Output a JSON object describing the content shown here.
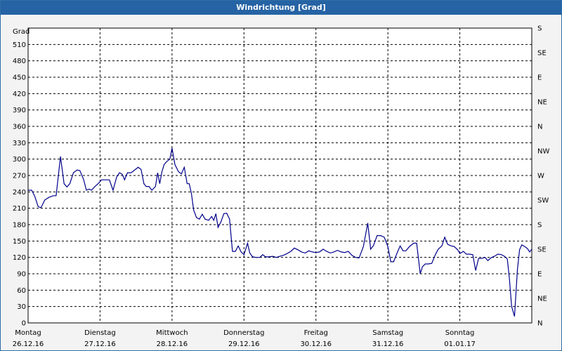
{
  "window": {
    "title": "Windrichtung [Grad]"
  },
  "chart_data": {
    "type": "line",
    "title": "Windrichtung [Grad]",
    "ylabel": "Grad",
    "ylim": [
      0,
      540
    ],
    "yticks": [
      0,
      30,
      60,
      90,
      120,
      150,
      180,
      210,
      240,
      270,
      300,
      330,
      360,
      390,
      420,
      450,
      480,
      510
    ],
    "right_axis_labels": [
      "N",
      "NE",
      "E",
      "SE",
      "S",
      "SW",
      "W",
      "NW",
      "N",
      "NE",
      "E",
      "SE",
      "S"
    ],
    "xlim": [
      0,
      7
    ],
    "day_labels": [
      {
        "day": "Montag",
        "date": "26.12.16"
      },
      {
        "day": "Dienstag",
        "date": "27.12.16"
      },
      {
        "day": "Mittwoch",
        "date": "28.12.16"
      },
      {
        "day": "Donnerstag",
        "date": "29.12.16"
      },
      {
        "day": "Freitag",
        "date": "30.12.16"
      },
      {
        "day": "Samstag",
        "date": "31.12.16"
      },
      {
        "day": "Sonntag",
        "date": "01.01.17"
      }
    ],
    "grid": true,
    "colors": {
      "line": "#00008b",
      "grid": "#000000",
      "background": "#ffffff",
      "titlebar": "#2563a4"
    },
    "series": [
      {
        "points": [
          [
            0.0,
            243
          ],
          [
            0.05,
            243
          ],
          [
            0.09,
            233
          ],
          [
            0.14,
            213
          ],
          [
            0.18,
            211
          ],
          [
            0.23,
            225
          ],
          [
            0.29,
            230
          ],
          [
            0.35,
            233
          ],
          [
            0.39,
            233
          ],
          [
            0.45,
            305
          ],
          [
            0.5,
            255
          ],
          [
            0.54,
            249
          ],
          [
            0.58,
            255
          ],
          [
            0.63,
            275
          ],
          [
            0.68,
            280
          ],
          [
            0.72,
            279
          ],
          [
            0.77,
            263
          ],
          [
            0.81,
            243
          ],
          [
            0.85,
            245
          ],
          [
            0.88,
            243
          ],
          [
            0.93,
            250
          ],
          [
            0.98,
            256
          ],
          [
            1.02,
            262
          ],
          [
            1.08,
            262
          ],
          [
            1.13,
            262
          ],
          [
            1.18,
            243
          ],
          [
            1.23,
            267
          ],
          [
            1.27,
            275
          ],
          [
            1.31,
            272
          ],
          [
            1.34,
            262
          ],
          [
            1.38,
            275
          ],
          [
            1.43,
            275
          ],
          [
            1.47,
            279
          ],
          [
            1.53,
            285
          ],
          [
            1.57,
            281
          ],
          [
            1.61,
            255
          ],
          [
            1.64,
            250
          ],
          [
            1.68,
            250
          ],
          [
            1.72,
            243
          ],
          [
            1.77,
            250
          ],
          [
            1.8,
            275
          ],
          [
            1.83,
            255
          ],
          [
            1.86,
            277
          ],
          [
            1.89,
            290
          ],
          [
            1.93,
            296
          ],
          [
            1.97,
            300
          ],
          [
            2.0,
            320
          ],
          [
            2.04,
            290
          ],
          [
            2.09,
            277
          ],
          [
            2.13,
            273
          ],
          [
            2.17,
            285
          ],
          [
            2.21,
            255
          ],
          [
            2.24,
            255
          ],
          [
            2.27,
            237
          ],
          [
            2.3,
            207
          ],
          [
            2.34,
            193
          ],
          [
            2.38,
            190
          ],
          [
            2.42,
            199
          ],
          [
            2.46,
            190
          ],
          [
            2.51,
            188
          ],
          [
            2.55,
            195
          ],
          [
            2.58,
            188
          ],
          [
            2.61,
            200
          ],
          [
            2.64,
            175
          ],
          [
            2.68,
            185
          ],
          [
            2.72,
            200
          ],
          [
            2.76,
            201
          ],
          [
            2.8,
            190
          ],
          [
            2.84,
            131
          ],
          [
            2.88,
            131
          ],
          [
            2.92,
            141
          ],
          [
            2.96,
            130
          ],
          [
            3.0,
            125
          ],
          [
            3.05,
            146
          ],
          [
            3.08,
            128
          ],
          [
            3.12,
            121
          ],
          [
            3.17,
            120
          ],
          [
            3.22,
            120
          ],
          [
            3.26,
            125
          ],
          [
            3.3,
            121
          ],
          [
            3.35,
            121
          ],
          [
            3.4,
            122
          ],
          [
            3.45,
            120
          ],
          [
            3.5,
            122
          ],
          [
            3.55,
            124
          ],
          [
            3.6,
            127
          ],
          [
            3.65,
            131
          ],
          [
            3.7,
            137
          ],
          [
            3.75,
            134
          ],
          [
            3.8,
            130
          ],
          [
            3.85,
            128
          ],
          [
            3.9,
            132
          ],
          [
            3.95,
            130
          ],
          [
            4.0,
            129
          ],
          [
            4.05,
            130
          ],
          [
            4.1,
            135
          ],
          [
            4.15,
            131
          ],
          [
            4.2,
            128
          ],
          [
            4.25,
            130
          ],
          [
            4.3,
            133
          ],
          [
            4.35,
            130
          ],
          [
            4.4,
            129
          ],
          [
            4.45,
            131
          ],
          [
            4.5,
            124
          ],
          [
            4.55,
            120
          ],
          [
            4.6,
            119
          ],
          [
            4.66,
            140
          ],
          [
            4.72,
            183
          ],
          [
            4.76,
            135
          ],
          [
            4.8,
            142
          ],
          [
            4.85,
            160
          ],
          [
            4.9,
            160
          ],
          [
            4.95,
            157
          ],
          [
            5.0,
            140
          ],
          [
            5.04,
            112
          ],
          [
            5.08,
            112
          ],
          [
            5.13,
            129
          ],
          [
            5.17,
            141
          ],
          [
            5.21,
            132
          ],
          [
            5.25,
            132
          ],
          [
            5.3,
            140
          ],
          [
            5.36,
            146
          ],
          [
            5.4,
            146
          ],
          [
            5.45,
            90
          ],
          [
            5.48,
            103
          ],
          [
            5.52,
            108
          ],
          [
            5.56,
            108
          ],
          [
            5.61,
            109
          ],
          [
            5.66,
            125
          ],
          [
            5.7,
            135
          ],
          [
            5.75,
            141
          ],
          [
            5.79,
            157
          ],
          [
            5.83,
            144
          ],
          [
            5.88,
            141
          ],
          [
            5.92,
            140
          ],
          [
            5.97,
            134
          ],
          [
            6.0,
            127
          ],
          [
            6.05,
            131
          ],
          [
            6.09,
            126
          ],
          [
            6.13,
            126
          ],
          [
            6.18,
            125
          ],
          [
            6.22,
            96
          ],
          [
            6.26,
            118
          ],
          [
            6.3,
            118
          ],
          [
            6.35,
            120
          ],
          [
            6.39,
            114
          ],
          [
            6.43,
            119
          ],
          [
            6.48,
            122
          ],
          [
            6.53,
            126
          ],
          [
            6.58,
            125
          ],
          [
            6.62,
            122
          ],
          [
            6.66,
            117
          ],
          [
            6.69,
            80
          ],
          [
            6.72,
            30
          ],
          [
            6.76,
            12
          ],
          [
            6.8,
            97
          ],
          [
            6.83,
            134
          ],
          [
            6.86,
            143
          ],
          [
            6.9,
            140
          ],
          [
            6.94,
            136
          ],
          [
            6.97,
            130
          ],
          [
            7.0,
            135
          ]
        ]
      }
    ]
  }
}
